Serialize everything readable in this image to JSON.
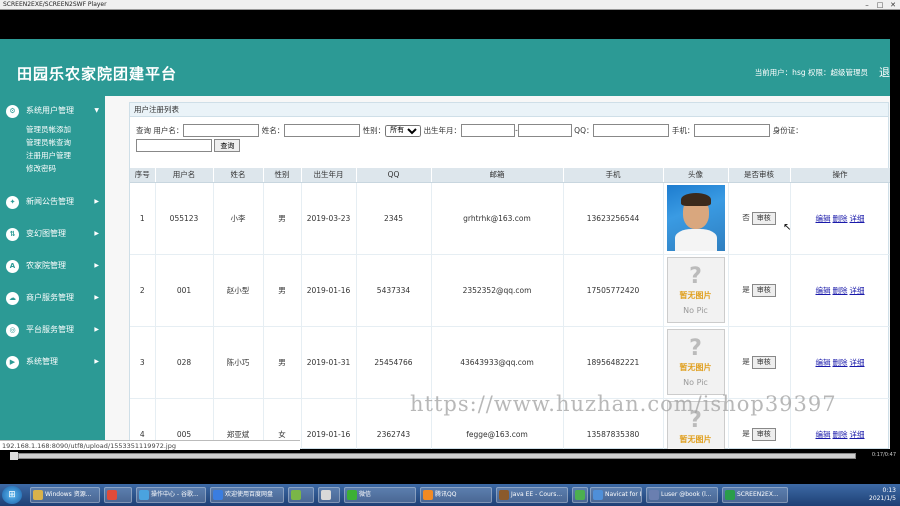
{
  "window": {
    "title": "SCREEN2EXE/SCREEN2SWF Player"
  },
  "header": {
    "title": "田园乐农家院团建平台",
    "user_info": "当前用户：hsg 权限：超级管理员",
    "logout": "退"
  },
  "sidebar": {
    "menus": [
      {
        "label": "系统用户管理",
        "icon": "gear-icon",
        "icon_glyph": "⚙"
      },
      {
        "label": "新闻公告管理",
        "icon": "people-icon",
        "icon_glyph": "✦"
      },
      {
        "label": "变幻图管理",
        "icon": "switch-icon",
        "icon_glyph": "⇅"
      },
      {
        "label": "农家院管理",
        "icon": "app-icon",
        "icon_glyph": "A"
      },
      {
        "label": "商户服务管理",
        "icon": "cloud-icon",
        "icon_glyph": "☁"
      },
      {
        "label": "平台服务管理",
        "icon": "target-icon",
        "icon_glyph": "◎"
      },
      {
        "label": "系统管理",
        "icon": "play-icon",
        "icon_glyph": "▶"
      }
    ],
    "submenu": [
      "管理员帐添加",
      "管理员帐查询",
      "注册用户管理",
      "修改密码"
    ]
  },
  "panel": {
    "title": "用户注册列表"
  },
  "search": {
    "label_prefix": "查询 用户名：",
    "name_label": "姓名：",
    "gender_label": "性别：",
    "gender_selected": "所有",
    "birth_label": "出生年月：",
    "birth_sep": "-",
    "qq_label": "QQ：",
    "phone_label": "手机：",
    "idcard_label": "身份证：",
    "button": "查询"
  },
  "table": {
    "headers": [
      "序号",
      "用户名",
      "姓名",
      "性别",
      "出生年月",
      "QQ",
      "邮箱",
      "手机",
      "头像",
      "是否审核",
      "操作"
    ],
    "rows": [
      {
        "no": "1",
        "username": "055123",
        "name": "小李",
        "gender": "男",
        "birth": "2019-03-23",
        "qq": "2345",
        "email": "grhtrhk@163.com",
        "phone": "13623256544",
        "avatar": "photo",
        "audited": "否",
        "audit_btn": "审核"
      },
      {
        "no": "2",
        "username": "001",
        "name": "赵小型",
        "gender": "男",
        "birth": "2019-01-16",
        "qq": "5437334",
        "email": "2352352@qq.com",
        "phone": "17505772420",
        "avatar": "nopic",
        "audited": "是",
        "audit_btn": "审核"
      },
      {
        "no": "3",
        "username": "028",
        "name": "陈小巧",
        "gender": "男",
        "birth": "2019-01-31",
        "qq": "25454766",
        "email": "43643933@qq.com",
        "phone": "18956482221",
        "avatar": "nopic",
        "audited": "是",
        "audit_btn": "审核"
      },
      {
        "no": "4",
        "username": "005",
        "name": "郑亚斌",
        "gender": "女",
        "birth": "2019-01-16",
        "qq": "2362743",
        "email": "fegge@163.com",
        "phone": "13587835380",
        "avatar": "nopic",
        "audited": "是",
        "audit_btn": "审核"
      }
    ],
    "ops": [
      "编辑",
      "删除",
      "详细"
    ],
    "nopic_cn": "暂无图片",
    "nopic_en": "No Pic"
  },
  "statusbar": {
    "text": "192.168.1.168:8090/utf8/upload/1553351119972.jpg"
  },
  "watermark": "https://www.huzhan.com/ishop39397",
  "player": {
    "time": "0:17/0:47"
  },
  "taskbar": {
    "items": [
      {
        "label": "Windows 资源...",
        "color": "#d9b24a"
      },
      {
        "label": "",
        "color": "#e04b3a"
      },
      {
        "label": "操作中心 - 谷歌...",
        "color": "#4aa3df"
      },
      {
        "label": "欢迎使用百度网盘",
        "color": "#3a7de0"
      },
      {
        "label": "",
        "color": "#7ab648"
      },
      {
        "label": "",
        "color": "#d8d8d8"
      },
      {
        "label": "微信",
        "color": "#3cb034"
      },
      {
        "label": "腾讯QQ",
        "color": "#f08a24"
      },
      {
        "label": "Java EE - Cours...",
        "color": "#8b5a2b"
      },
      {
        "label": "",
        "color": "#4caf50"
      },
      {
        "label": "Navicat for My...",
        "color": "#4f8fd8"
      },
      {
        "label": "Luser @book (l...",
        "color": "#6a7fb0"
      },
      {
        "label": "SCREEN2EX...",
        "color": "#2a9d4a"
      }
    ],
    "clock_time": "0:13",
    "clock_date": "2021/1/5"
  }
}
